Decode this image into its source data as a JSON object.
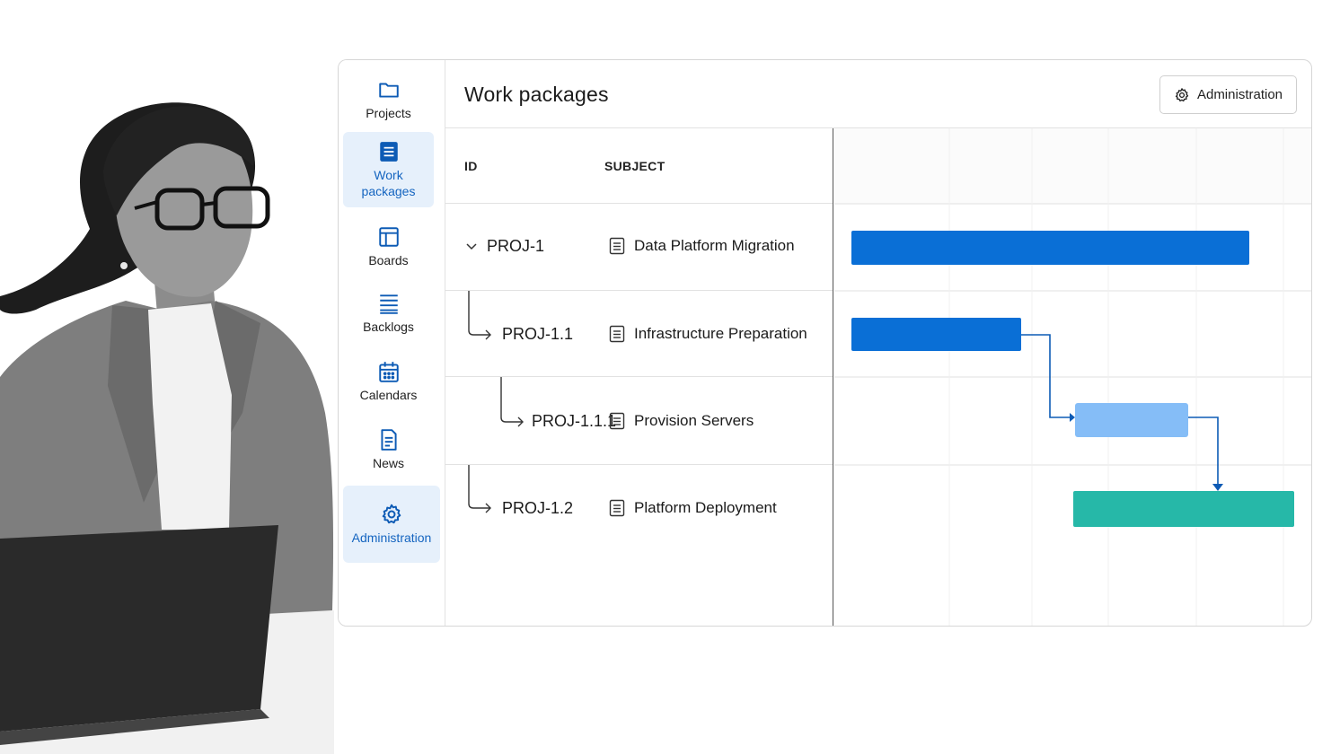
{
  "app": {
    "page_title": "Work packages",
    "admin_button_label": "Administration"
  },
  "sidebar": {
    "items": [
      {
        "label": "Projects",
        "icon": "folder-icon",
        "active": false
      },
      {
        "label": "Work\npackages",
        "icon": "list-icon",
        "active": true
      },
      {
        "label": "Boards",
        "icon": "board-icon",
        "active": false
      },
      {
        "label": "Backlogs",
        "icon": "backlog-icon",
        "active": false
      },
      {
        "label": "Calendars",
        "icon": "calendar-icon",
        "active": false
      },
      {
        "label": "News",
        "icon": "news-icon",
        "active": false
      },
      {
        "label": "Administration",
        "icon": "gear-icon",
        "active": true
      }
    ]
  },
  "table": {
    "headers": {
      "id": "ID",
      "subject": "SUBJECT"
    },
    "rows": [
      {
        "id": "PROJ-1",
        "subject": "Data Platform Migration",
        "level": 0,
        "expanded": true
      },
      {
        "id": "PROJ-1.1",
        "subject": "Infrastructure Preparation",
        "level": 1
      },
      {
        "id": "PROJ-1.1.1",
        "subject": "Provision Servers",
        "level": 2
      },
      {
        "id": "PROJ-1.2",
        "subject": "Platform Deployment",
        "level": 1
      }
    ]
  },
  "gantt": {
    "bar_colors": [
      "#0a6fd6",
      "#0a6fd6",
      "#85bdf7",
      "#26b8a8"
    ],
    "dependency_color": "#0d5bb5"
  }
}
